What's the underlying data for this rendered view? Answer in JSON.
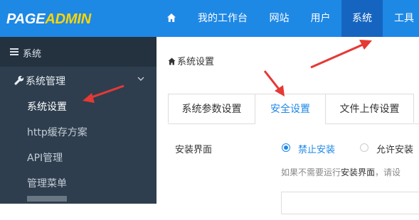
{
  "logo": {
    "part1": "PAGE",
    "part2": "ADMIN"
  },
  "nav": {
    "items": [
      {
        "label": "我的工作台"
      },
      {
        "label": "网站"
      },
      {
        "label": "用户"
      },
      {
        "label": "系统"
      },
      {
        "label": "工具"
      }
    ],
    "active": "系统"
  },
  "sidebar": {
    "section_label": "系统",
    "group_label": "系统管理",
    "items": [
      {
        "label": "系统设置"
      },
      {
        "label": "http缓存方案"
      },
      {
        "label": "API管理"
      },
      {
        "label": "管理菜单"
      }
    ]
  },
  "breadcrumb": {
    "label": "系统设置"
  },
  "tabs": [
    {
      "label": "系统参数设置"
    },
    {
      "label": "安全设置"
    },
    {
      "label": "文件上传设置"
    }
  ],
  "form": {
    "label": "安装界面",
    "options": [
      {
        "label": "禁止安装",
        "selected": true
      },
      {
        "label": "允许安装",
        "selected": false
      }
    ],
    "help_prefix": "如果不需要运行",
    "help_bold": "安装界面",
    "help_suffix": "，请设"
  },
  "colors": {
    "header": "#1E88E5",
    "nav_active": "#1565C0",
    "sidebar": "#2E3E4E",
    "accent": "#1E88E5",
    "logo_yellow": "#FFD600",
    "arrow": "#E53935"
  }
}
